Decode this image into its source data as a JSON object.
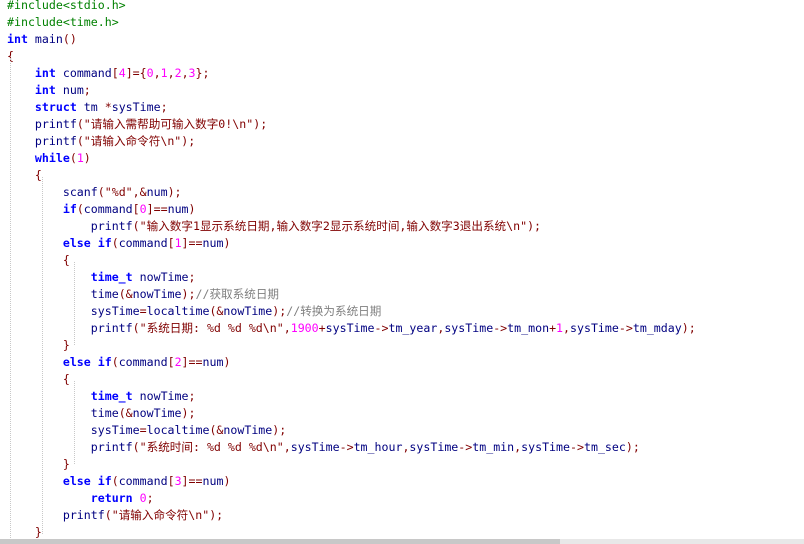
{
  "editor": {
    "lines": [
      [
        [
          "pre",
          "#include<stdio.h>"
        ]
      ],
      [
        [
          "pre",
          "#include<time.h>"
        ]
      ],
      [
        [
          "kw",
          "int"
        ],
        [
          "id",
          " main"
        ],
        [
          "op",
          "()"
        ]
      ],
      [
        [
          "op",
          "{"
        ]
      ],
      [
        [
          "id",
          "    "
        ],
        [
          "kw",
          "int"
        ],
        [
          "id",
          " command"
        ],
        [
          "op",
          "["
        ],
        [
          "num",
          "4"
        ],
        [
          "op",
          "]={"
        ],
        [
          "num",
          "0"
        ],
        [
          "op",
          ","
        ],
        [
          "num",
          "1"
        ],
        [
          "op",
          ","
        ],
        [
          "num",
          "2"
        ],
        [
          "op",
          ","
        ],
        [
          "num",
          "3"
        ],
        [
          "op",
          "};"
        ]
      ],
      [
        [
          "id",
          "    "
        ],
        [
          "kw",
          "int"
        ],
        [
          "id",
          " num"
        ],
        [
          "op",
          ";"
        ]
      ],
      [
        [
          "id",
          "    "
        ],
        [
          "kw",
          "struct"
        ],
        [
          "id",
          " tm "
        ],
        [
          "op",
          "*"
        ],
        [
          "id",
          "sysTime"
        ],
        [
          "op",
          ";"
        ]
      ],
      [
        [
          "id",
          "    printf"
        ],
        [
          "op",
          "("
        ],
        [
          "str",
          "\"请输入需帮助可输入数字0!\\n\""
        ],
        [
          "op",
          ");"
        ]
      ],
      [
        [
          "id",
          "    printf"
        ],
        [
          "op",
          "("
        ],
        [
          "str",
          "\"请输入命令符\\n\""
        ],
        [
          "op",
          ");"
        ]
      ],
      [
        [
          "id",
          "    "
        ],
        [
          "kw",
          "while"
        ],
        [
          "op",
          "("
        ],
        [
          "num",
          "1"
        ],
        [
          "op",
          ")"
        ]
      ],
      [
        [
          "id",
          "    "
        ],
        [
          "op",
          "{"
        ]
      ],
      [
        [
          "id",
          "        scanf"
        ],
        [
          "op",
          "("
        ],
        [
          "str",
          "\"%d\""
        ],
        [
          "op",
          ",&"
        ],
        [
          "id",
          "num"
        ],
        [
          "op",
          ");"
        ]
      ],
      [
        [
          "id",
          "        "
        ],
        [
          "kw",
          "if"
        ],
        [
          "op",
          "("
        ],
        [
          "id",
          "command"
        ],
        [
          "op",
          "["
        ],
        [
          "num",
          "0"
        ],
        [
          "op",
          "]=="
        ],
        [
          "id",
          "num"
        ],
        [
          "op",
          ")"
        ]
      ],
      [
        [
          "id",
          "            printf"
        ],
        [
          "op",
          "("
        ],
        [
          "str",
          "\"输入数字1显示系统日期,输入数字2显示系统时间,输入数字3退出系统\\n\""
        ],
        [
          "op",
          ");"
        ]
      ],
      [
        [
          "id",
          "        "
        ],
        [
          "kw",
          "else"
        ],
        [
          "id",
          " "
        ],
        [
          "kw",
          "if"
        ],
        [
          "op",
          "("
        ],
        [
          "id",
          "command"
        ],
        [
          "op",
          "["
        ],
        [
          "num",
          "1"
        ],
        [
          "op",
          "]=="
        ],
        [
          "id",
          "num"
        ],
        [
          "op",
          ")"
        ]
      ],
      [
        [
          "id",
          "        "
        ],
        [
          "op",
          "{"
        ]
      ],
      [
        [
          "id",
          "            "
        ],
        [
          "kw",
          "time_t"
        ],
        [
          "id",
          " nowTime"
        ],
        [
          "op",
          ";"
        ]
      ],
      [
        [
          "id",
          "            time"
        ],
        [
          "op",
          "(&"
        ],
        [
          "id",
          "nowTime"
        ],
        [
          "op",
          ");"
        ],
        [
          "cmt",
          "//获取系统日期"
        ]
      ],
      [
        [
          "id",
          "            sysTime"
        ],
        [
          "op",
          "="
        ],
        [
          "id",
          "localtime"
        ],
        [
          "op",
          "(&"
        ],
        [
          "id",
          "nowTime"
        ],
        [
          "op",
          ");"
        ],
        [
          "cmt",
          "//转换为系统日期"
        ]
      ],
      [
        [
          "id",
          "            printf"
        ],
        [
          "op",
          "("
        ],
        [
          "str",
          "\"系统日期: %d %d %d\\n\""
        ],
        [
          "op",
          ","
        ],
        [
          "num",
          "1900"
        ],
        [
          "op",
          "+"
        ],
        [
          "id",
          "sysTime"
        ],
        [
          "op",
          "->"
        ],
        [
          "id",
          "tm_year"
        ],
        [
          "op",
          ","
        ],
        [
          "id",
          "sysTime"
        ],
        [
          "op",
          "->"
        ],
        [
          "id",
          "tm_mon"
        ],
        [
          "op",
          "+"
        ],
        [
          "num",
          "1"
        ],
        [
          "op",
          ","
        ],
        [
          "id",
          "sysTime"
        ],
        [
          "op",
          "->"
        ],
        [
          "id",
          "tm_mday"
        ],
        [
          "op",
          ");"
        ]
      ],
      [
        [
          "id",
          "        "
        ],
        [
          "op",
          "}"
        ]
      ],
      [
        [
          "id",
          "        "
        ],
        [
          "kw",
          "else"
        ],
        [
          "id",
          " "
        ],
        [
          "kw",
          "if"
        ],
        [
          "op",
          "("
        ],
        [
          "id",
          "command"
        ],
        [
          "op",
          "["
        ],
        [
          "num",
          "2"
        ],
        [
          "op",
          "]=="
        ],
        [
          "id",
          "num"
        ],
        [
          "op",
          ")"
        ]
      ],
      [
        [
          "id",
          "        "
        ],
        [
          "op",
          "{"
        ]
      ],
      [
        [
          "id",
          "            "
        ],
        [
          "kw",
          "time_t"
        ],
        [
          "id",
          " nowTime"
        ],
        [
          "op",
          ";"
        ]
      ],
      [
        [
          "id",
          "            time"
        ],
        [
          "op",
          "(&"
        ],
        [
          "id",
          "nowTime"
        ],
        [
          "op",
          ");"
        ]
      ],
      [
        [
          "id",
          "            sysTime"
        ],
        [
          "op",
          "="
        ],
        [
          "id",
          "localtime"
        ],
        [
          "op",
          "(&"
        ],
        [
          "id",
          "nowTime"
        ],
        [
          "op",
          ");"
        ]
      ],
      [
        [
          "id",
          "            printf"
        ],
        [
          "op",
          "("
        ],
        [
          "str",
          "\"系统时间: %d %d %d\\n\""
        ],
        [
          "op",
          ","
        ],
        [
          "id",
          "sysTime"
        ],
        [
          "op",
          "->"
        ],
        [
          "id",
          "tm_hour"
        ],
        [
          "op",
          ","
        ],
        [
          "id",
          "sysTime"
        ],
        [
          "op",
          "->"
        ],
        [
          "id",
          "tm_min"
        ],
        [
          "op",
          ","
        ],
        [
          "id",
          "sysTime"
        ],
        [
          "op",
          "->"
        ],
        [
          "id",
          "tm_sec"
        ],
        [
          "op",
          ");"
        ]
      ],
      [
        [
          "id",
          "        "
        ],
        [
          "op",
          "}"
        ]
      ],
      [
        [
          "id",
          "        "
        ],
        [
          "kw",
          "else"
        ],
        [
          "id",
          " "
        ],
        [
          "kw",
          "if"
        ],
        [
          "op",
          "("
        ],
        [
          "id",
          "command"
        ],
        [
          "op",
          "["
        ],
        [
          "num",
          "3"
        ],
        [
          "op",
          "]=="
        ],
        [
          "id",
          "num"
        ],
        [
          "op",
          ")"
        ]
      ],
      [
        [
          "id",
          "            "
        ],
        [
          "kw",
          "return"
        ],
        [
          "id",
          " "
        ],
        [
          "num",
          "0"
        ],
        [
          "op",
          ";"
        ]
      ],
      [
        [
          "id",
          "        printf"
        ],
        [
          "op",
          "("
        ],
        [
          "str",
          "\"请输入命令符\\n\""
        ],
        [
          "op",
          ");"
        ]
      ],
      [
        [
          "id",
          "    "
        ],
        [
          "op",
          "}"
        ]
      ]
    ]
  }
}
